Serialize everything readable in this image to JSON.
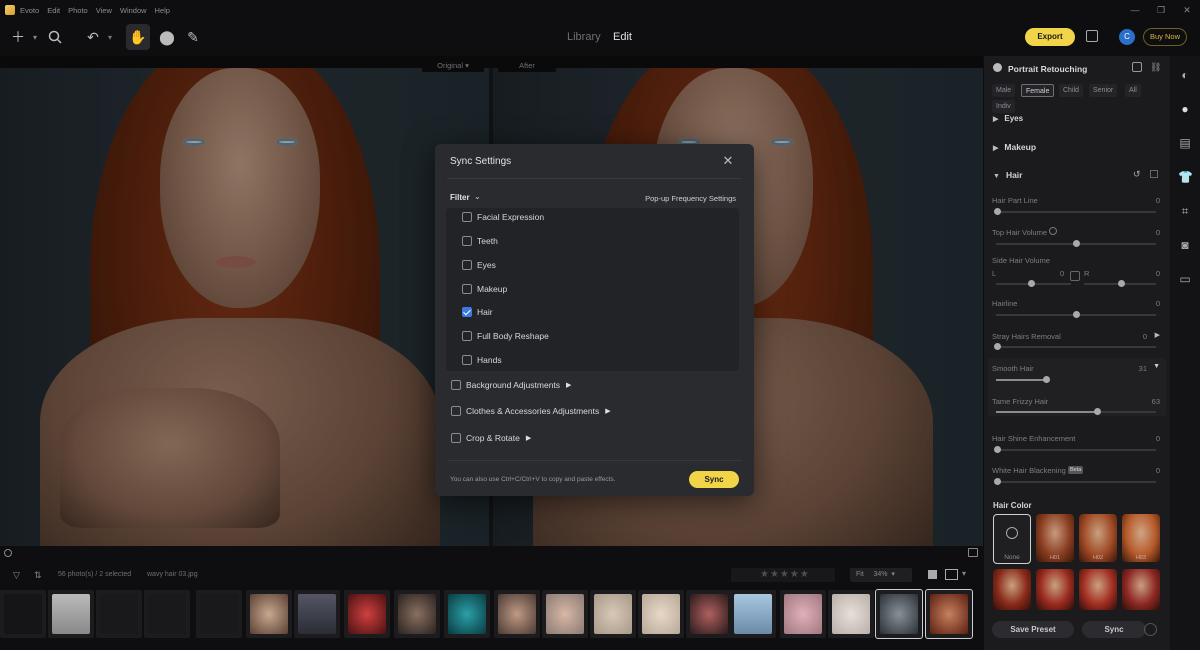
{
  "titlebar": {
    "app_name": "Evoto",
    "menus": [
      "Edit",
      "Photo",
      "View",
      "Window",
      "Help"
    ],
    "controls": [
      "—",
      "❐",
      "✕"
    ]
  },
  "toolbar": {
    "tabs": {
      "library": "Library",
      "edit": "Edit"
    },
    "export_label": "Export",
    "avatar_letter": "C",
    "buy_now_label": "Buy Now",
    "icons": [
      "add-icon",
      "search-icon",
      "undo-icon",
      "hand-icon",
      "stamp-icon",
      "brush-icon"
    ]
  },
  "canvas": {
    "original_label": "Original",
    "after_label": "After"
  },
  "modal": {
    "title": "Sync Settings",
    "filter_label": "Filter",
    "popup_frequency_label": "Pop-up Frequency Settings",
    "sub_items": [
      {
        "label": "Facial Expression",
        "checked": false
      },
      {
        "label": "Teeth",
        "checked": false
      },
      {
        "label": "Eyes",
        "checked": false
      },
      {
        "label": "Makeup",
        "checked": false
      },
      {
        "label": "Hair",
        "checked": true
      },
      {
        "label": "Full Body Reshape",
        "checked": false
      },
      {
        "label": "Hands",
        "checked": false
      }
    ],
    "groups": [
      {
        "label": "Background Adjustments",
        "checked": false
      },
      {
        "label": "Clothes & Accessories Adjustments",
        "checked": false
      },
      {
        "label": "Crop & Rotate",
        "checked": false
      }
    ],
    "hint": "You can also use Ctrl+C/Ctrl+V to copy and paste effects.",
    "sync_label": "Sync"
  },
  "panel": {
    "title": "Portrait Retouching",
    "chips": [
      "Male",
      "Female",
      "Child",
      "Senior",
      "All",
      "Indiv"
    ],
    "active_chip": "Female",
    "sections": {
      "eyes": "Eyes",
      "makeup": "Makeup",
      "hair": "Hair"
    },
    "sliders": [
      {
        "label": "Hair Part Line",
        "value": "0"
      },
      {
        "label": "Top Hair Volume",
        "value": "0"
      },
      {
        "label": "Side Hair Volume",
        "value": ""
      },
      {
        "label": "Hairline",
        "value": "0"
      },
      {
        "label": "Stray Hairs Removal",
        "value": "0"
      },
      {
        "label": "Smooth Hair",
        "value": "31"
      },
      {
        "label": "Tame Frizzy Hair",
        "value": "63"
      },
      {
        "label": "Hair Shine Enhancement",
        "value": "0"
      },
      {
        "label": "White Hair Blackening",
        "value": "0"
      }
    ],
    "side_volume": {
      "left_label": "L",
      "left_value": "0",
      "right_label": "R",
      "right_value": "0"
    },
    "beta_badge": "Beta",
    "hair_color_label": "Hair Color",
    "none_label": "None",
    "swatch_labels": [
      "H01",
      "H02",
      "H03"
    ],
    "save_preset_label": "Save Preset",
    "sync_label": "Sync"
  },
  "filmstrip": {
    "count_text": "56 photo(s) / 2 selected",
    "filename": "wavy hair 03.jpg",
    "fit_label": "Fit",
    "zoom": "34%"
  }
}
